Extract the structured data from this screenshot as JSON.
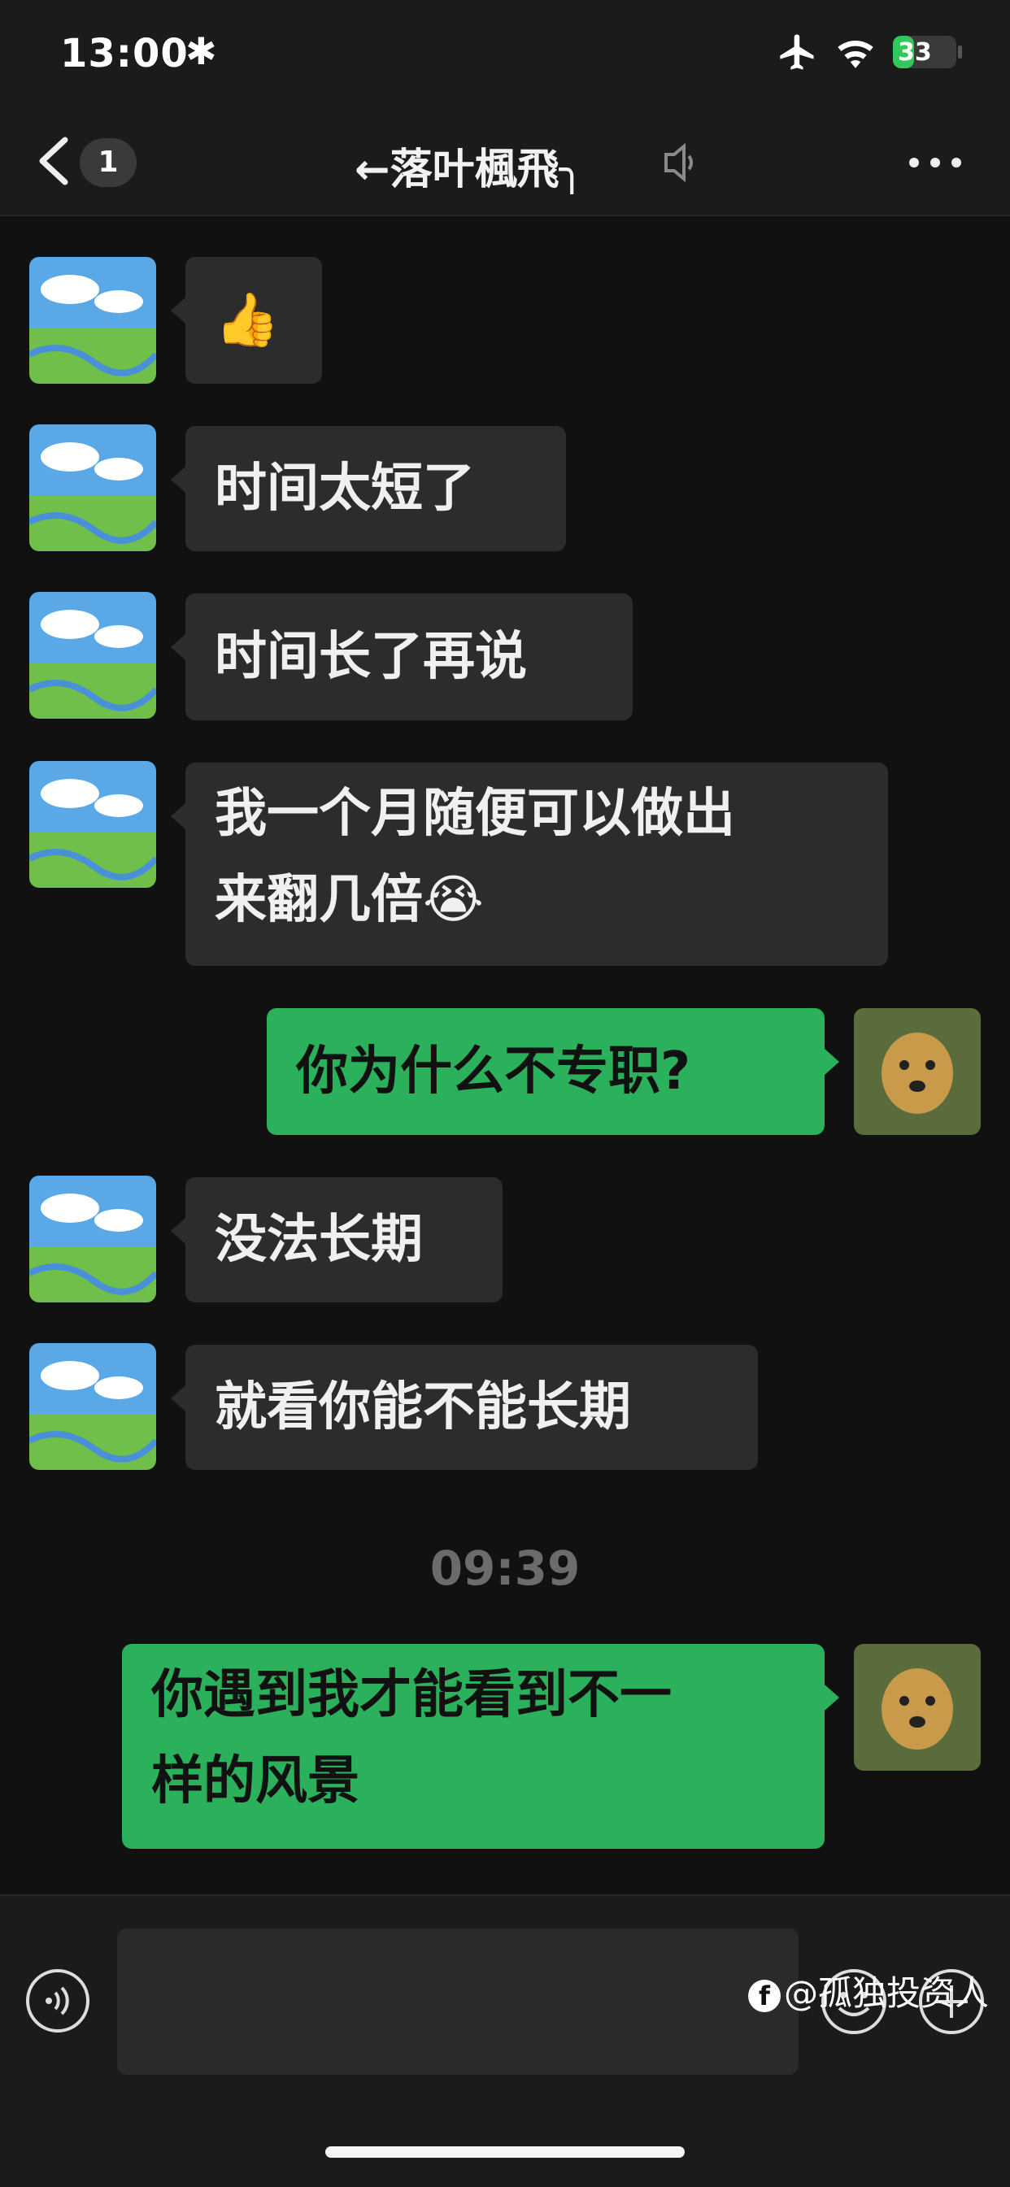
{
  "status_bar": {
    "time": "13:00",
    "battery": "33",
    "battery_level": 0.33
  },
  "nav": {
    "unread_badge": "1",
    "title": "←落叶楓飛╮"
  },
  "messages": [
    {
      "side": "in",
      "text": "👍"
    },
    {
      "side": "in",
      "text": "时间太短了"
    },
    {
      "side": "in",
      "text": "时间长了再说"
    },
    {
      "side": "in",
      "line1": "我一个月随便可以做出",
      "line2": "来翻几倍😭"
    },
    {
      "side": "out",
      "text": "你为什么不专职?"
    },
    {
      "side": "in",
      "text": "没法长期"
    },
    {
      "side": "in",
      "text": "就看你能不能长期"
    },
    {
      "side": "out",
      "line1": "你遇到我才能看到不一",
      "line2": "样的风景"
    }
  ],
  "timestamp": "09:39",
  "input": {
    "placeholder": ""
  },
  "watermark": "@孤独投资人",
  "icons": {
    "status": [
      "airplane-icon",
      "wifi-icon",
      "battery-icon"
    ],
    "nav": [
      "chevron-left-icon",
      "sound-icon",
      "more-icon"
    ],
    "input": [
      "voice-icon",
      "emoji-icon",
      "plus-icon"
    ]
  },
  "colors": {
    "outgoing_bubble": "#2bb05c",
    "incoming_bubble": "#2c2c2c",
    "background": "#111111"
  }
}
